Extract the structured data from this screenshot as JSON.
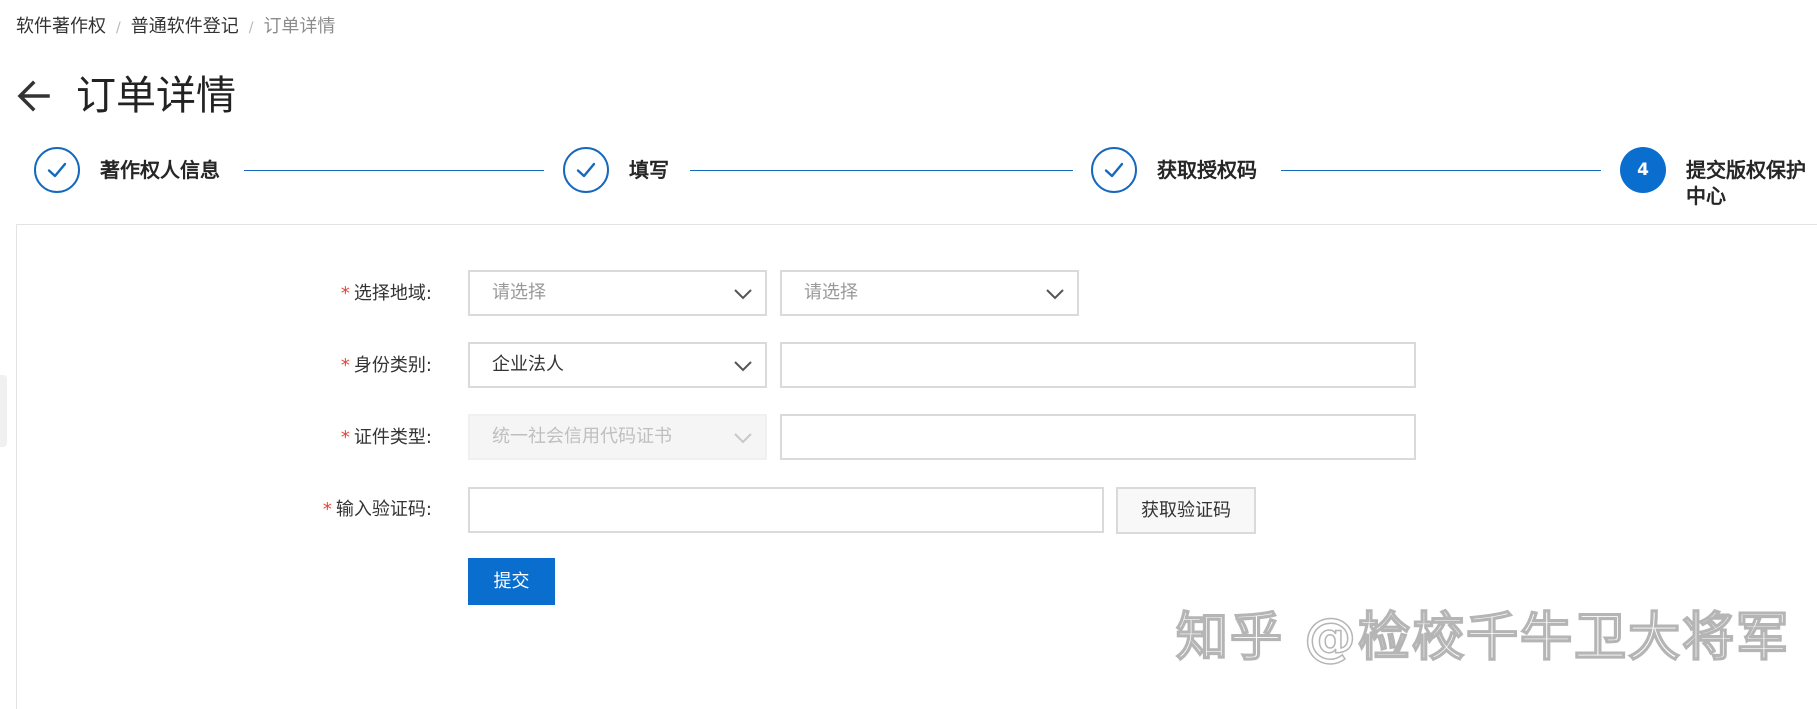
{
  "breadcrumb": {
    "items": [
      "软件著作权",
      "普通软件登记",
      "订单详情"
    ],
    "separator": "/"
  },
  "page": {
    "title": "订单详情",
    "back_icon": "arrow-left-icon"
  },
  "steps": {
    "items": [
      {
        "label": "著作权人信息",
        "status": "done",
        "icon": "check-icon"
      },
      {
        "label": "填写",
        "status": "done",
        "icon": "check-icon"
      },
      {
        "label": "获取授权码",
        "status": "done",
        "icon": "check-icon"
      },
      {
        "label": "提交版权保护中心",
        "status": "active",
        "number": "4"
      }
    ]
  },
  "form": {
    "region": {
      "label": "选择地域:",
      "select1_placeholder": "请选择",
      "select2_placeholder": "请选择"
    },
    "identity": {
      "label": "身份类别:",
      "select_value": "企业法人",
      "input_value": ""
    },
    "certificate": {
      "label": "证件类型:",
      "select_value": "统一社会信用代码证书",
      "select_disabled": true,
      "input_value": ""
    },
    "verification": {
      "label": "输入验证码:",
      "input_value": "",
      "get_code_label": "获取验证码"
    },
    "required_mark": "*",
    "submit_label": "提交"
  },
  "watermark": {
    "text": "知乎 @检校千牛卫大将军"
  },
  "colors": {
    "primary": "#0a6ecf",
    "step_line": "#1569bc",
    "required": "#e8423a",
    "border": "#dadada"
  }
}
